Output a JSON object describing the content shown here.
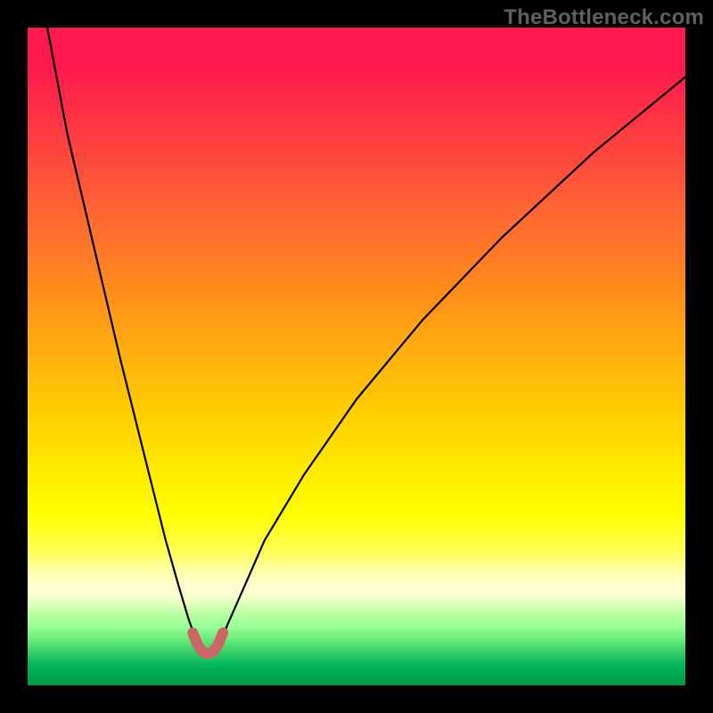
{
  "watermark": "TheBottleneck.com",
  "chart_data": {
    "type": "line",
    "title": "",
    "xlabel": "",
    "ylabel": "",
    "xlim": [
      0,
      100
    ],
    "ylim": [
      0,
      100
    ],
    "grid": false,
    "series": [
      {
        "name": "bottleneck-curve",
        "x": [
          3,
          6,
          10,
          14,
          18,
          21,
          23,
          24.5,
          25.8,
          26.8,
          27.5,
          28.2,
          29.2,
          30.5,
          32.5,
          36,
          42,
          50,
          60,
          72,
          86,
          100
        ],
        "y": [
          0,
          16,
          33,
          50,
          66,
          78,
          85,
          90,
          93.6,
          95.1,
          95.4,
          95.1,
          93.6,
          90.5,
          86,
          78,
          68,
          56.5,
          44.5,
          32,
          19,
          7.5
        ]
      },
      {
        "name": "accent-valley",
        "x": [
          25.1,
          25.9,
          26.6,
          27.4,
          28.2,
          28.9,
          29.7
        ],
        "y": [
          92.0,
          93.9,
          94.9,
          95.2,
          94.9,
          93.9,
          92.0
        ]
      }
    ],
    "colors": {
      "curve": "#000000",
      "accent": "#cc6666",
      "gradient_top": "#ff1a4d",
      "gradient_mid": "#ffff00",
      "gradient_bottom": "#009944"
    }
  }
}
